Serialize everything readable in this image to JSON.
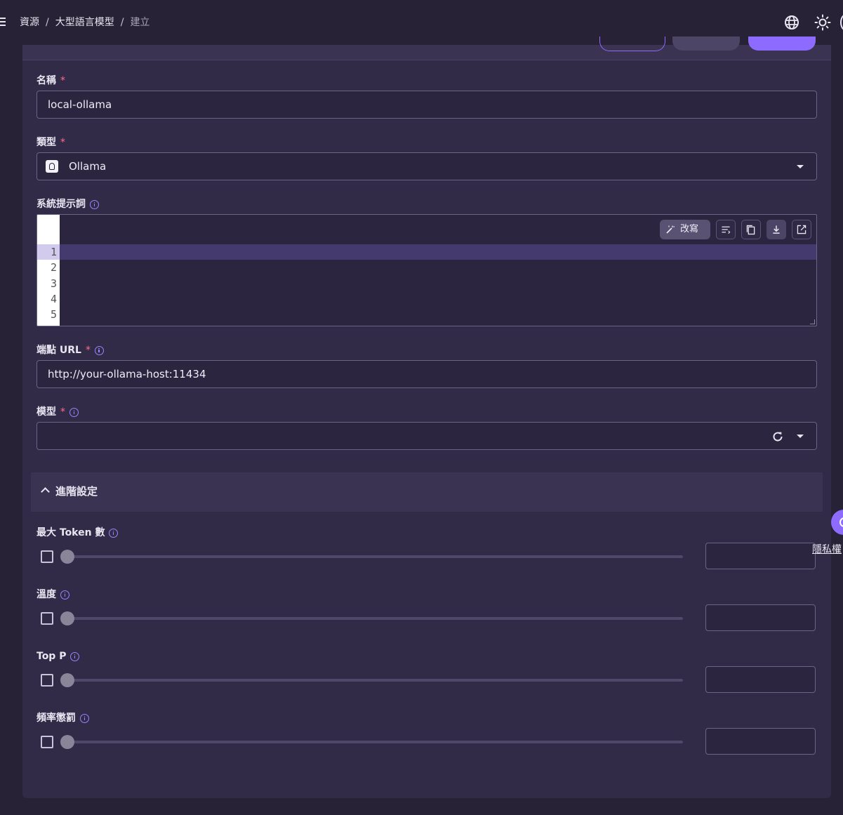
{
  "breadcrumb": {
    "level1": "資源",
    "level2": "大型語言模型",
    "current": "建立",
    "separator": "/"
  },
  "topbar_icons": [
    "globe-icon",
    "sun-icon"
  ],
  "form": {
    "name": {
      "label": "名稱",
      "required_mark": "*",
      "value": "local-ollama"
    },
    "type": {
      "label": "類型",
      "required_mark": "*",
      "value": "Ollama",
      "icon": "ollama-logo-icon"
    },
    "system_prompt": {
      "label": "系統提示詞",
      "rewrite_label": "改寫",
      "line_numbers": [
        "1",
        "2",
        "3",
        "4",
        "5"
      ],
      "active_line": 1,
      "toolbar_icons": [
        "format-icon",
        "copy-icon",
        "download-icon",
        "open-external-icon"
      ]
    },
    "endpoint": {
      "label": "端點 URL",
      "required_mark": "*",
      "value": "http://your-ollama-host:11434"
    },
    "model": {
      "label": "模型",
      "required_mark": "*",
      "value": ""
    }
  },
  "advanced": {
    "title": "進階設定",
    "expanded": true,
    "params": [
      {
        "label": "最大 Token 數",
        "checked": false,
        "slider_fraction": 0,
        "value": ""
      },
      {
        "label": "溫度",
        "checked": false,
        "slider_fraction": 0,
        "value": ""
      },
      {
        "label": "Top P",
        "checked": false,
        "slider_fraction": 0,
        "value": ""
      },
      {
        "label": "頻率懲罰",
        "checked": false,
        "slider_fraction": 0,
        "value": ""
      }
    ]
  },
  "privacy_link": "隱私權",
  "colors": {
    "background": "#272236",
    "card": "#312b47",
    "accent": "#8d6bff",
    "required": "#ff6b8b"
  }
}
